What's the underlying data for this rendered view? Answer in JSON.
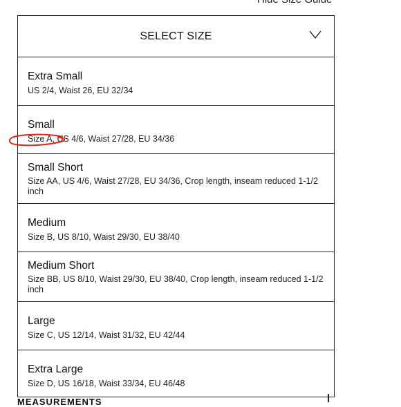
{
  "top_link": "Hide Size Guide",
  "selector": {
    "header_label": "SELECT SIZE",
    "options": [
      {
        "name": "Extra Small",
        "desc": "US 2/4, Waist 26, EU 32/34"
      },
      {
        "name": "Small",
        "desc": "Size A, US 4/6, Waist 27/28, EU 34/36"
      },
      {
        "name": "Small Short",
        "desc": "Size AA, US 4/6, Waist 27/28, EU 34/36, Crop length, inseam reduced 1-1/2 inch"
      },
      {
        "name": "Medium",
        "desc": "Size B, US 8/10, Waist 29/30, EU 38/40"
      },
      {
        "name": "Medium Short",
        "desc": "Size BB, US 8/10, Waist 29/30, EU 38/40, Crop length, inseam reduced 1-1/2 inch"
      },
      {
        "name": "Large",
        "desc": "Size C, US 12/14, Waist 31/32, EU 42/44"
      },
      {
        "name": "Extra Large",
        "desc": "Size D, US 16/18, Waist 33/34, EU 46/48"
      }
    ]
  },
  "bottom_heading": "MEASUREMENTS",
  "icons": {
    "chevron": "chevron-down-icon",
    "annotation": "hand-drawn-red-circle"
  },
  "colors": {
    "border": "#222222",
    "annotation": "#d9261c"
  }
}
